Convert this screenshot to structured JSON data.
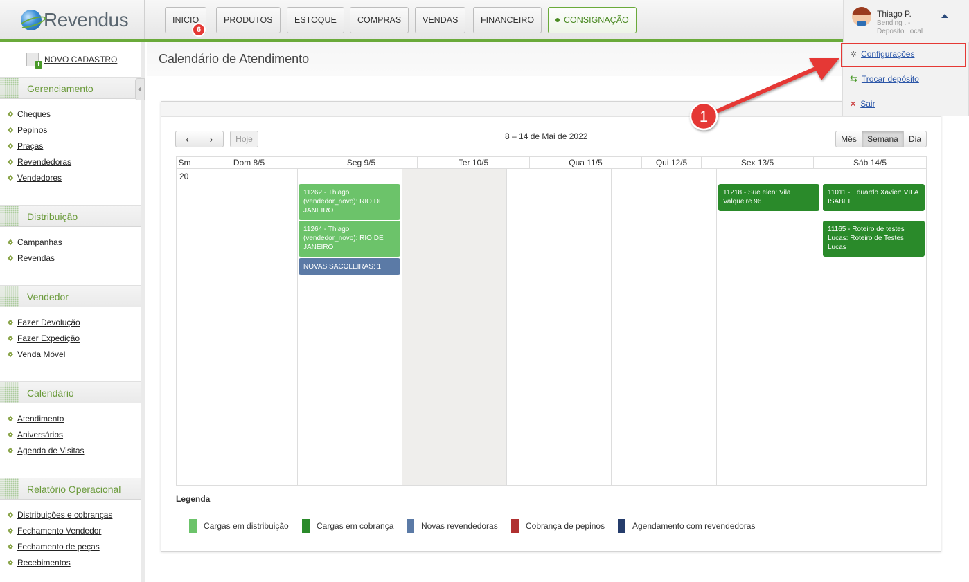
{
  "app": {
    "logo": "Revendus",
    "nav": {
      "inicio": "INICIO",
      "produtos": "PRODUTOS",
      "estoque": "ESTOQUE",
      "compras": "COMPRAS",
      "vendas": "VENDAS",
      "financeiro": "FINANCEIRO",
      "consignacao": "CONSIGNAÇÃO",
      "badge": "6"
    },
    "user": {
      "name": "Thiago P.",
      "line1": "Bending . -",
      "line2": "Deposito Local",
      "menu": {
        "configuracoes": "Configurações",
        "trocar": "Trocar depósito",
        "sair": "Sair"
      }
    }
  },
  "sidebar": {
    "novo_cadastro": "NOVO CADASTRO",
    "sections": {
      "gerenciamento": {
        "title": "Gerenciamento",
        "items": [
          "Cheques",
          "Pepinos",
          "Praças",
          "Revendedoras",
          "Vendedores"
        ]
      },
      "distribuicao": {
        "title": "Distribuição",
        "items": [
          "Campanhas",
          "Revendas"
        ]
      },
      "vendedor": {
        "title": "Vendedor",
        "items": [
          "Fazer Devolução",
          "Fazer Expedição",
          "Venda Móvel"
        ]
      },
      "calendario": {
        "title": "Calendário",
        "items": [
          "Atendimento",
          "Aniversários",
          "Agenda de Visitas"
        ]
      },
      "relatorio": {
        "title": "Relatório Operacional",
        "items": [
          "Distribuições e cobranças",
          "Fechamento Vendedor",
          "Fechamento de peças",
          "Recebimentos"
        ]
      }
    }
  },
  "main": {
    "title": "Calendário de Atendimento",
    "calendar": {
      "today": "Hoje",
      "range": "8 – 14 de Mai de 2022",
      "views": {
        "month": "Mês",
        "week": "Semana",
        "day": "Dia"
      },
      "week_col_label": "Sm",
      "week_number": "20",
      "days": [
        "Dom 8/5",
        "Seg 9/5",
        "Ter 10/5",
        "Qua 11/5",
        "Qui 12/5",
        "Sex 13/5",
        "Sáb 14/5"
      ],
      "events": {
        "mon_1": "11262 - Thiago (vendedor_novo): RIO DE JANEIRO",
        "mon_2": "11264 - Thiago (vendedor_novo): RIO DE JANEIRO",
        "mon_3": "NOVAS SACOLEIRAS: 1",
        "fri_1": "11218 - Sue elen: Vila Valqueire 96",
        "sat_1": "11011 - Eduardo Xavier: VILA ISABEL",
        "sat_2": "11165 - Roteiro de testes Lucas: Roteiro de Testes Lucas"
      }
    },
    "legend": {
      "title": "Legenda",
      "items": [
        {
          "label": "Cargas em distribuição",
          "color": "#6cc36a"
        },
        {
          "label": "Cargas em cobrança",
          "color": "#2a8a2a"
        },
        {
          "label": "Novas revendedoras",
          "color": "#5b7aa6"
        },
        {
          "label": "Cobrança de pepinos",
          "color": "#b03030"
        },
        {
          "label": "Agendamento com revendedoras",
          "color": "#253c6b"
        }
      ]
    }
  },
  "annotation": {
    "marker": "1"
  }
}
